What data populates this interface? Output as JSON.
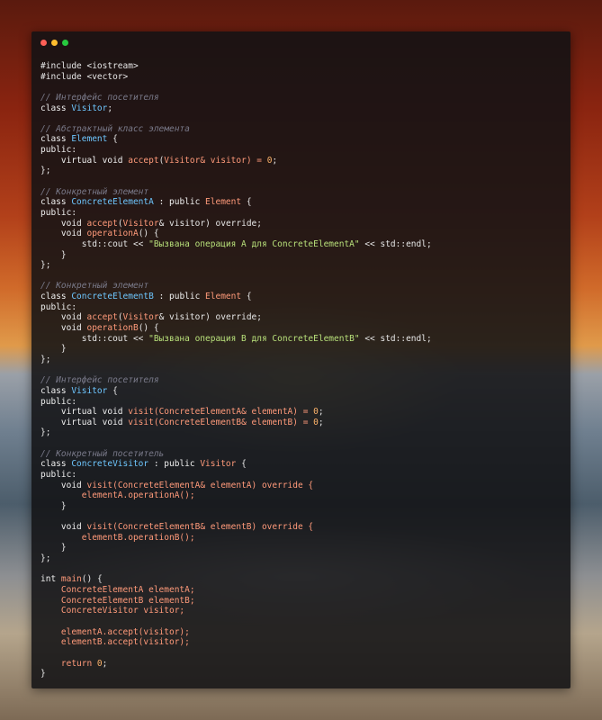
{
  "window": {
    "controls": [
      "close",
      "minimize",
      "zoom"
    ]
  },
  "code_lines": [
    [
      {
        "t": "#include <iostream>",
        "c": "plain"
      }
    ],
    [
      {
        "t": "#include <vector>",
        "c": "plain"
      }
    ],
    [],
    [
      {
        "t": "// Интерфейс посетителя",
        "c": "comment"
      }
    ],
    [
      {
        "t": "class ",
        "c": "kw"
      },
      {
        "t": "Visitor",
        "c": "type"
      },
      {
        "t": ";",
        "c": "plain"
      }
    ],
    [],
    [
      {
        "t": "// Абстрактный класс элемента",
        "c": "comment"
      }
    ],
    [
      {
        "t": "class ",
        "c": "kw"
      },
      {
        "t": "Element",
        "c": "type"
      },
      {
        "t": " {",
        "c": "plain"
      }
    ],
    [
      {
        "t": "public:",
        "c": "kw"
      }
    ],
    [
      {
        "t": "    virtual void ",
        "c": "kw"
      },
      {
        "t": "accept",
        "c": "fn"
      },
      {
        "t": "(",
        "c": "plain"
      },
      {
        "t": "Visitor",
        "c": "fn"
      },
      {
        "t": "& visitor) = ",
        "c": "fn"
      },
      {
        "t": "0",
        "c": "num"
      },
      {
        "t": ";",
        "c": "plain"
      }
    ],
    [
      {
        "t": "};",
        "c": "plain"
      }
    ],
    [],
    [
      {
        "t": "// Конкретный элемент",
        "c": "comment"
      }
    ],
    [
      {
        "t": "class ",
        "c": "kw"
      },
      {
        "t": "ConcreteElementA",
        "c": "type"
      },
      {
        "t": " : public ",
        "c": "kw"
      },
      {
        "t": "Element",
        "c": "fn"
      },
      {
        "t": " {",
        "c": "plain"
      }
    ],
    [
      {
        "t": "public:",
        "c": "kw"
      }
    ],
    [
      {
        "t": "    void ",
        "c": "kw"
      },
      {
        "t": "accept",
        "c": "fn"
      },
      {
        "t": "(",
        "c": "plain"
      },
      {
        "t": "Visitor",
        "c": "fn"
      },
      {
        "t": "& visitor) override;",
        "c": "plain"
      }
    ],
    [
      {
        "t": "    void ",
        "c": "kw"
      },
      {
        "t": "operationA",
        "c": "fn"
      },
      {
        "t": "() {",
        "c": "plain"
      }
    ],
    [
      {
        "t": "        std::cout << ",
        "c": "plain"
      },
      {
        "t": "\"Вызвана операция A для ConcreteElementA\"",
        "c": "str"
      },
      {
        "t": " << std::endl;",
        "c": "plain"
      }
    ],
    [
      {
        "t": "    }",
        "c": "plain"
      }
    ],
    [
      {
        "t": "};",
        "c": "plain"
      }
    ],
    [],
    [
      {
        "t": "// Конкретный элемент",
        "c": "comment"
      }
    ],
    [
      {
        "t": "class ",
        "c": "kw"
      },
      {
        "t": "ConcreteElementB",
        "c": "type"
      },
      {
        "t": " : public ",
        "c": "kw"
      },
      {
        "t": "Element",
        "c": "fn"
      },
      {
        "t": " {",
        "c": "plain"
      }
    ],
    [
      {
        "t": "public:",
        "c": "kw"
      }
    ],
    [
      {
        "t": "    void ",
        "c": "kw"
      },
      {
        "t": "accept",
        "c": "fn"
      },
      {
        "t": "(",
        "c": "plain"
      },
      {
        "t": "Visitor",
        "c": "fn"
      },
      {
        "t": "& visitor) override;",
        "c": "plain"
      }
    ],
    [
      {
        "t": "    void ",
        "c": "kw"
      },
      {
        "t": "operationB",
        "c": "fn"
      },
      {
        "t": "() {",
        "c": "plain"
      }
    ],
    [
      {
        "t": "        std::cout << ",
        "c": "plain"
      },
      {
        "t": "\"Вызвана операция B для ConcreteElementB\"",
        "c": "str"
      },
      {
        "t": " << std::endl;",
        "c": "plain"
      }
    ],
    [
      {
        "t": "    }",
        "c": "plain"
      }
    ],
    [
      {
        "t": "};",
        "c": "plain"
      }
    ],
    [],
    [
      {
        "t": "// Интерфейс посетителя",
        "c": "comment"
      }
    ],
    [
      {
        "t": "class ",
        "c": "kw"
      },
      {
        "t": "Visitor",
        "c": "type"
      },
      {
        "t": " {",
        "c": "plain"
      }
    ],
    [
      {
        "t": "public:",
        "c": "kw"
      }
    ],
    [
      {
        "t": "    virtual void ",
        "c": "kw"
      },
      {
        "t": "visit",
        "c": "fn"
      },
      {
        "t": "(ConcreteElementA& elementA) = ",
        "c": "fn"
      },
      {
        "t": "0",
        "c": "num"
      },
      {
        "t": ";",
        "c": "plain"
      }
    ],
    [
      {
        "t": "    virtual void ",
        "c": "kw"
      },
      {
        "t": "visit",
        "c": "fn"
      },
      {
        "t": "(ConcreteElementB& elementB) = ",
        "c": "fn"
      },
      {
        "t": "0",
        "c": "num"
      },
      {
        "t": ";",
        "c": "plain"
      }
    ],
    [
      {
        "t": "};",
        "c": "plain"
      }
    ],
    [],
    [
      {
        "t": "// Конкретный посетитель",
        "c": "comment"
      }
    ],
    [
      {
        "t": "class ",
        "c": "kw"
      },
      {
        "t": "ConcreteVisitor",
        "c": "type"
      },
      {
        "t": " : public ",
        "c": "kw"
      },
      {
        "t": "Visitor",
        "c": "fn"
      },
      {
        "t": " {",
        "c": "plain"
      }
    ],
    [
      {
        "t": "public:",
        "c": "kw"
      }
    ],
    [
      {
        "t": "    void ",
        "c": "kw"
      },
      {
        "t": "visit",
        "c": "fn"
      },
      {
        "t": "(ConcreteElementA& elementA) override {",
        "c": "fn"
      }
    ],
    [
      {
        "t": "        elementA.operationA();",
        "c": "fn"
      }
    ],
    [
      {
        "t": "    }",
        "c": "plain"
      }
    ],
    [],
    [
      {
        "t": "    void ",
        "c": "kw"
      },
      {
        "t": "visit",
        "c": "fn"
      },
      {
        "t": "(ConcreteElementB& elementB) override {",
        "c": "fn"
      }
    ],
    [
      {
        "t": "        elementB.operationB();",
        "c": "fn"
      }
    ],
    [
      {
        "t": "    }",
        "c": "plain"
      }
    ],
    [
      {
        "t": "};",
        "c": "plain"
      }
    ],
    [],
    [
      {
        "t": "int ",
        "c": "kw"
      },
      {
        "t": "main",
        "c": "fn"
      },
      {
        "t": "() {",
        "c": "plain"
      }
    ],
    [
      {
        "t": "    ConcreteElementA elementA;",
        "c": "fn"
      }
    ],
    [
      {
        "t": "    ConcreteElementB elementB;",
        "c": "fn"
      }
    ],
    [
      {
        "t": "    ConcreteVisitor visitor;",
        "c": "fn"
      }
    ],
    [],
    [
      {
        "t": "    elementA.accept(visitor);",
        "c": "fn"
      }
    ],
    [
      {
        "t": "    elementB.accept(visitor);",
        "c": "fn"
      }
    ],
    [],
    [
      {
        "t": "    return ",
        "c": "fn"
      },
      {
        "t": "0",
        "c": "num"
      },
      {
        "t": ";",
        "c": "plain"
      }
    ],
    [
      {
        "t": "}",
        "c": "plain"
      }
    ]
  ]
}
